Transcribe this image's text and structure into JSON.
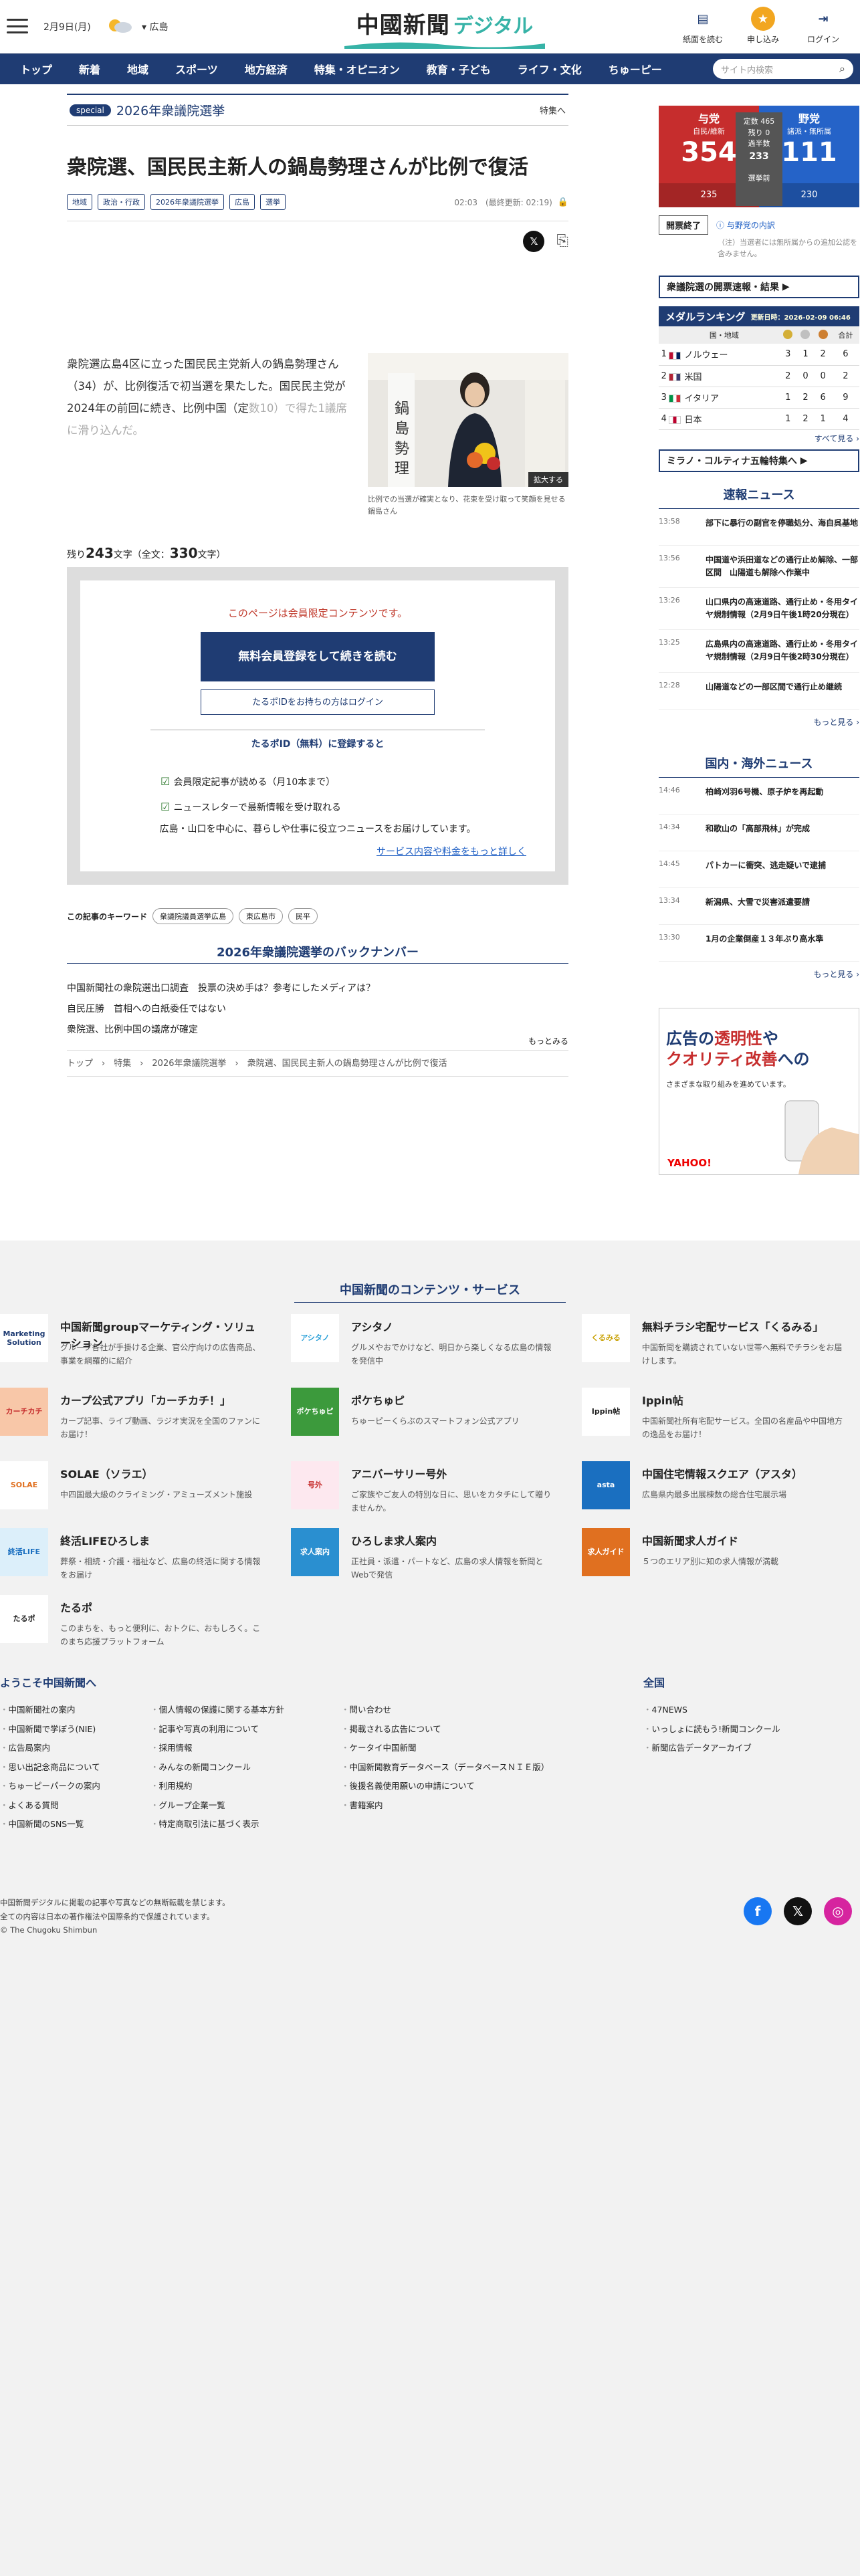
{
  "header": {
    "date": "2月9日(月)",
    "region": "広島",
    "logo_main": "中國新聞",
    "logo_sub": "デジタル",
    "icons": [
      {
        "label": "紙面を読む",
        "icon": "newspaper-icon"
      },
      {
        "label": "申し込み",
        "icon": "apply-icon"
      },
      {
        "label": "ログイン",
        "icon": "login-icon"
      }
    ]
  },
  "nav": {
    "items": [
      "トップ",
      "新着",
      "地域",
      "スポーツ",
      "地方経済",
      "特集・オピニオン",
      "教育・子ども",
      "ライフ・文化",
      "ちゅーピー"
    ],
    "search_placeholder": "サイト内検索"
  },
  "article": {
    "special_tag": "special",
    "special_title": "2026年衆議院選挙",
    "special_more": "特集へ",
    "title": "衆院選、国民民主新人の鍋島勢理さんが比例で復活",
    "tags": [
      "地域",
      "政治・行政",
      "2026年衆議院選挙",
      "広島",
      "選挙"
    ],
    "time": "02:03　(最終更新: 02:19)",
    "lead": "衆院選広島4区に立った国民民主党新人の鍋島勢理さん（34）が、比例復活で初当選を果たした。国民民主党が2024年の前回に続き、比例中国（定",
    "lead_fade": "数10）で得た1議席に滑り込んだ。",
    "photo_enlarge": "拡大する",
    "photo_caption": "比例での当選が確実となり、花束を受け取って笑顔を見せる鍋島さん",
    "remain_prefix": "残り",
    "remain_chars": "243",
    "remain_mid": "文字（全文：",
    "total_chars": "330",
    "remain_suffix": "文字）",
    "paywall": {
      "limited": "このページは会員限定コンテンツです。",
      "register": "無料会員登録をして続きを読む",
      "login": "たるポIDをお持ちの方はログイン",
      "register_title": "たるポID（無料）に登録すると",
      "benefits": [
        "会員限定記事が読める（月10本まで）",
        "ニュースレターで最新情報を受け取れる"
      ],
      "desc": "広島・山口を中心に、暮らしや仕事に役立つニュースをお届けしています。",
      "service_link": "サービス内容や料金をもっと詳しく"
    },
    "keywords_label": "この記事のキーワード",
    "keywords": [
      "衆議院議員選挙広島",
      "東広島市",
      "民平"
    ],
    "back_title": "2026年衆議院選挙のバックナンバー",
    "back_items": [
      "中国新聞社の衆院選出口調査　投票の決め手は？参考にしたメディアは？",
      "自民圧勝　首相への白紙委任ではない",
      "衆院選、比例中国の議席が確定"
    ],
    "back_more": "もっとみる",
    "breadcrumb": "トップ　›　特集　›　2026年衆議院選挙　›　衆院選、国民民主新人の鍋島勢理さんが比例で復活"
  },
  "sidebar": {
    "election": {
      "left_party": "与党",
      "left_sub": "自民/維新",
      "left_num": "354",
      "left_bottom": "235",
      "mid_lines": [
        "定数 465",
        "残り 0",
        "過半数",
        "233",
        "選挙前"
      ],
      "right_party": "野党",
      "right_sub": "諸派・無所属",
      "right_num": "111",
      "right_bottom": "230",
      "status": "開票終了",
      "link": "与野党の内訳",
      "note": "（注）当選者には無所属からの追加公認を含みません。",
      "results_link": "衆議院選の開票速報・結果"
    },
    "medal": {
      "title": "メダルランキング",
      "updated": "更新日時：2026-02-09 06:46",
      "headers": [
        "国・地域",
        "合計"
      ],
      "rows": [
        {
          "rank": "1",
          "country": "ノルウェー",
          "gold": "3",
          "silver": "1",
          "bronze": "2",
          "total": "6",
          "flag": [
            "#ba0c2f",
            "#fff",
            "#00205b"
          ]
        },
        {
          "rank": "2",
          "country": "米国",
          "gold": "2",
          "silver": "0",
          "bronze": "0",
          "total": "2",
          "flag": [
            "#b22234",
            "#fff",
            "#3c3b6e"
          ]
        },
        {
          "rank": "3",
          "country": "イタリア",
          "gold": "1",
          "silver": "2",
          "bronze": "6",
          "total": "9",
          "flag": [
            "#009246",
            "#fff",
            "#ce2b37"
          ]
        },
        {
          "rank": "4",
          "country": "日本",
          "gold": "1",
          "silver": "2",
          "bronze": "1",
          "total": "4",
          "flag": [
            "#fff",
            "#bc002d",
            "#fff"
          ]
        }
      ],
      "all_link": "すべて見る ›"
    },
    "milano_link": "ミラノ・コルティナ五輪特集へ",
    "breaking": {
      "title": "速報ニュース",
      "items": [
        {
          "time": "13:58",
          "text": "部下に暴行の副官を停職処分、海自呉基地"
        },
        {
          "time": "13:56",
          "text": "中国道や浜田道などの通行止め解除、一部区間　山陽道も解除へ作業中"
        },
        {
          "time": "13:26",
          "text": "山口県内の高速道路、通行止め・冬用タイヤ規制情報（2月9日午後1時20分現在）"
        },
        {
          "time": "13:25",
          "text": "広島県内の高速道路、通行止め・冬用タイヤ規制情報（2月9日午後2時30分現在）"
        },
        {
          "time": "12:28",
          "text": "山陽道などの一部区間で通行止め継続"
        }
      ],
      "more": "もっと見る ›"
    },
    "national": {
      "title": "国内・海外ニュース",
      "items": [
        {
          "time": "14:46",
          "text": "柏崎刈羽6号機、原子炉を再起動"
        },
        {
          "time": "14:34",
          "text": "和歌山の「高部飛林」が完成"
        },
        {
          "time": "14:45",
          "text": "パトカーに衝突、逃走疑いで逮捕"
        },
        {
          "time": "13:34",
          "text": "新潟県、大雪で災害派遣要請"
        },
        {
          "time": "13:30",
          "text": "1月の企業倒産１３年ぶり高水準"
        }
      ],
      "more": "もっと見る ›"
    },
    "ad": {
      "line1a": "広告の",
      "line1b": "透明性",
      "line1c": "や",
      "line2a": "クオリティ改善",
      "line2b": "への",
      "line3": "さまざまな取り組みを進めています。",
      "brand": "YAHOO!"
    }
  },
  "footer": {
    "contents_title": "中国新聞のコンテンツ・サービス",
    "services": [
      {
        "name": "中国新聞groupマーケティング・ソリューション",
        "desc": "グループ各社が手掛ける企業、官公庁向けの広告商品、事業を網羅的に紹介",
        "logo": "Marketing Solution",
        "color": "#fff",
        "fg": "#1f3c73"
      },
      {
        "name": "アシタノ",
        "desc": "グルメやおでかけなど、明日から楽しくなる広島の情報を発信中",
        "logo": "アシタノ",
        "color": "#fff",
        "fg": "#2aa0d8"
      },
      {
        "name": "無料チラシ宅配サービス「くるみる」",
        "desc": "中国新聞を購読されていない世帯へ無料でチラシをお届けします。",
        "logo": "くるみる",
        "color": "#fff",
        "fg": "#c8a000"
      },
      {
        "name": "カープ公式アプリ「カーチカチ！」",
        "desc": "カープ記事、ライブ動画、ラジオ実況を全国のファンにお届け！",
        "logo": "カーチカチ",
        "color": "#f8c7a8",
        "fg": "#c62d2d"
      },
      {
        "name": "ポケちゅピ",
        "desc": "ちゅーピーくらぶのスマートフォン公式アプリ",
        "logo": "ポケちゅピ",
        "color": "#3c9a3c",
        "fg": "#fff"
      },
      {
        "name": "Ippin帖",
        "desc": "中国新聞社所有宅配サービス。全国の名産品や中国地方の逸品をお届け！",
        "logo": "Ippin帖",
        "color": "#fff",
        "fg": "#222"
      },
      {
        "name": "SOLAE（ソラエ）",
        "desc": "中四国最大級のクライミング・アミューズメント施設",
        "logo": "SOLAE",
        "color": "#fff",
        "fg": "#e07020"
      },
      {
        "name": "アニバーサリー号外",
        "desc": "ご家族やご友人の特別な日に、思いをカタチにして贈りませんか。",
        "logo": "号外",
        "color": "#fde8ef",
        "fg": "#c62d2d"
      },
      {
        "name": "中国住宅情報スクエア（アスタ）",
        "desc": "広島県内最多出展棟数の総合住宅展示場",
        "logo": "asta",
        "color": "#1a6fc0",
        "fg": "#fff"
      },
      {
        "name": "終活LIFEひろしま",
        "desc": "葬祭・相続・介護・福祉など、広島の終活に関する情報をお届け",
        "logo": "終活LIFE",
        "color": "#dceffa",
        "fg": "#1a6fc0"
      },
      {
        "name": "ひろしま求人案内",
        "desc": "正社員・派遣・パートなど、広島の求人情報を新聞とWebで発信",
        "logo": "求人案内",
        "color": "#2a8fd0",
        "fg": "#fff"
      },
      {
        "name": "中国新聞求人ガイド",
        "desc": "５つのエリア別に知の求人情報が満載",
        "logo": "求人ガイド",
        "color": "#e07020",
        "fg": "#fff"
      },
      {
        "name": "たるポ",
        "desc": "このまちを、もっと便利に、おトクに、おもしろく。このまち応援プラットフォーム",
        "logo": "たるポ",
        "color": "#fff",
        "fg": "#222"
      }
    ],
    "welcome_title": "ようこそ中国新聞へ",
    "col1": [
      "中国新聞社の案内",
      "中国新聞で学ぼう(NIE)",
      "広告局案内",
      "思い出記念商品について",
      "ちゅーピーパークの案内",
      "よくある質問",
      "中国新聞のSNS一覧"
    ],
    "col2": [
      "個人情報の保護に関する基本方針",
      "記事や写真の利用について",
      "採用情報",
      "みんなの新聞コンクール",
      "利用規約",
      "グループ企業一覧",
      "特定商取引法に基づく表示"
    ],
    "col3": [
      "問い合わせ",
      "掲載される広告について",
      "ケータイ中国新聞",
      "中国新聞教育データベース（データベースＮＩＥ版）",
      "後援名義使用願いの申請について",
      "書籍案内"
    ],
    "zenkoku_title": "全国",
    "col4": [
      "47NEWS",
      "いっしょに読もう!新聞コンクール",
      "新聞広告データアーカイブ"
    ],
    "copyright": [
      "中国新聞デジタルに掲載の記事や写真などの無断転載を禁じます。",
      "全ての内容は日本の著作権法や国際条約で保護されています。",
      "© The Chugoku Shimbun"
    ]
  }
}
